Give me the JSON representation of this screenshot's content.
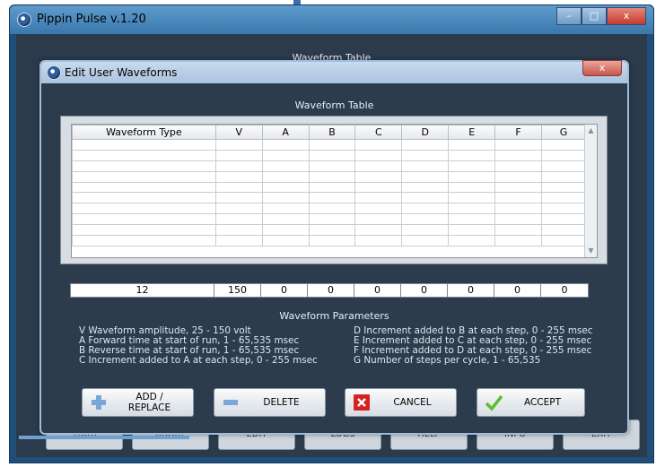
{
  "app": {
    "title": "Pippin Pulse v.1.20",
    "window_buttons": [
      "–",
      "□",
      "x"
    ],
    "caption": "Waveform Table",
    "bottom_buttons": [
      "START",
      "ABORT",
      "EDIT",
      "LOGS",
      "HELP",
      "INFO",
      "EXIT"
    ]
  },
  "dialog": {
    "title": "Edit User Waveforms",
    "close_label": "x",
    "table_title": "Waveform Table",
    "columns": [
      "Waveform Type",
      "V",
      "A",
      "B",
      "C",
      "D",
      "E",
      "F",
      "G"
    ],
    "empty_rows": 10,
    "input_values": [
      "12",
      "150",
      "0",
      "0",
      "0",
      "0",
      "0",
      "0",
      "0"
    ],
    "params_title": "Waveform Parameters",
    "params_left": [
      "V  Waveform amplitude, 25 - 150 volt",
      "A  Forward time at start of run, 1 - 65,535 msec",
      "B  Reverse time at start of run, 1 - 65,535 msec",
      "C  Increment added to A at each step, 0 - 255 msec"
    ],
    "params_right": [
      "D  Increment added to B at each step, 0 - 255 msec",
      "E  Increment added to C at each step, 0 - 255 msec",
      "F  Increment added to D at each step, 0 - 255 msec",
      "G  Number of steps per cycle,  1 - 65,535"
    ],
    "buttons": {
      "add_replace": "ADD / REPLACE",
      "delete": "DELETE",
      "cancel": "CANCEL",
      "accept": "ACCEPT"
    }
  },
  "colors": {
    "window_bg": "#2b3b4c",
    "title_gradient": "#5f9ccd",
    "accent_blue": "#3a78ad"
  }
}
